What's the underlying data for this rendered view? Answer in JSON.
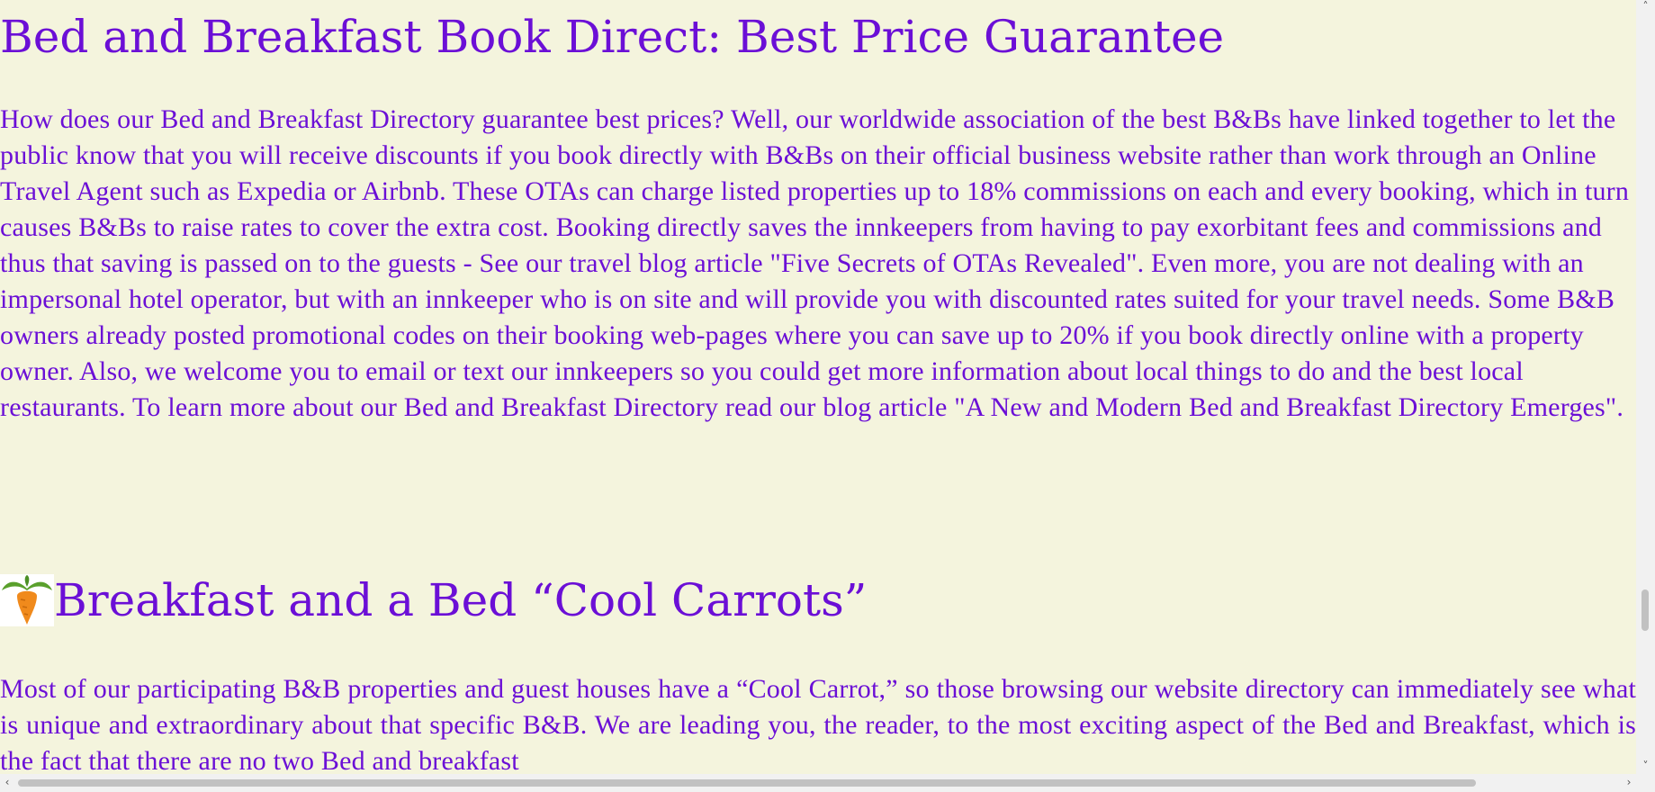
{
  "section_price": {
    "heading": "Bed and Breakfast Book Direct: Best Price Guarantee",
    "body": "How does our Bed and Breakfast Directory guarantee best prices? Well, our worldwide association of the best B&Bs have linked together to let the public know that you will receive discounts if you book directly with B&Bs on their official business website rather than work through an Online Travel Agent such as Expedia or Airbnb. These OTAs can charge listed properties up to 18% commissions on each and every booking, which in turn causes B&Bs to raise rates to cover the extra cost. Booking directly saves the innkeepers from having to pay exorbitant fees and commissions and thus that saving is passed on to the guests - See our travel blog article \"Five Secrets of OTAs Revealed\". Even more, you are not dealing with an impersonal hotel operator, but with an innkeeper who is on site and will provide you with discounted rates suited for your travel needs. Some B&B owners already posted promotional codes on their booking web-pages where you can save up to 20% if you book directly online with a property owner. Also, we welcome you to email or text our innkeepers so you could get more information about local things to do and the best local restaurants. To learn more about our Bed and Breakfast Directory read our blog article \"A New and Modern Bed and Breakfast Directory Emerges\"."
  },
  "section_carrots": {
    "icon": "carrot-icon",
    "heading": "Breakfast and a Bed “Cool Carrots”",
    "body": "Most of our participating B&B properties and guest houses have a “Cool Carrot,” so those browsing our website directory can immediately see what is unique and extraordinary about that specific B&B. We are leading you, the reader, to the most exciting aspect of the Bed and Breakfast, which is the fact that there are no two Bed and breakfast"
  },
  "scrollbars": {
    "up_arrow": "˄",
    "down_arrow": "˅",
    "left_arrow": "‹",
    "right_arrow": "›"
  },
  "colors": {
    "text": "#6b0fd6",
    "background": "#f4f4dd"
  }
}
